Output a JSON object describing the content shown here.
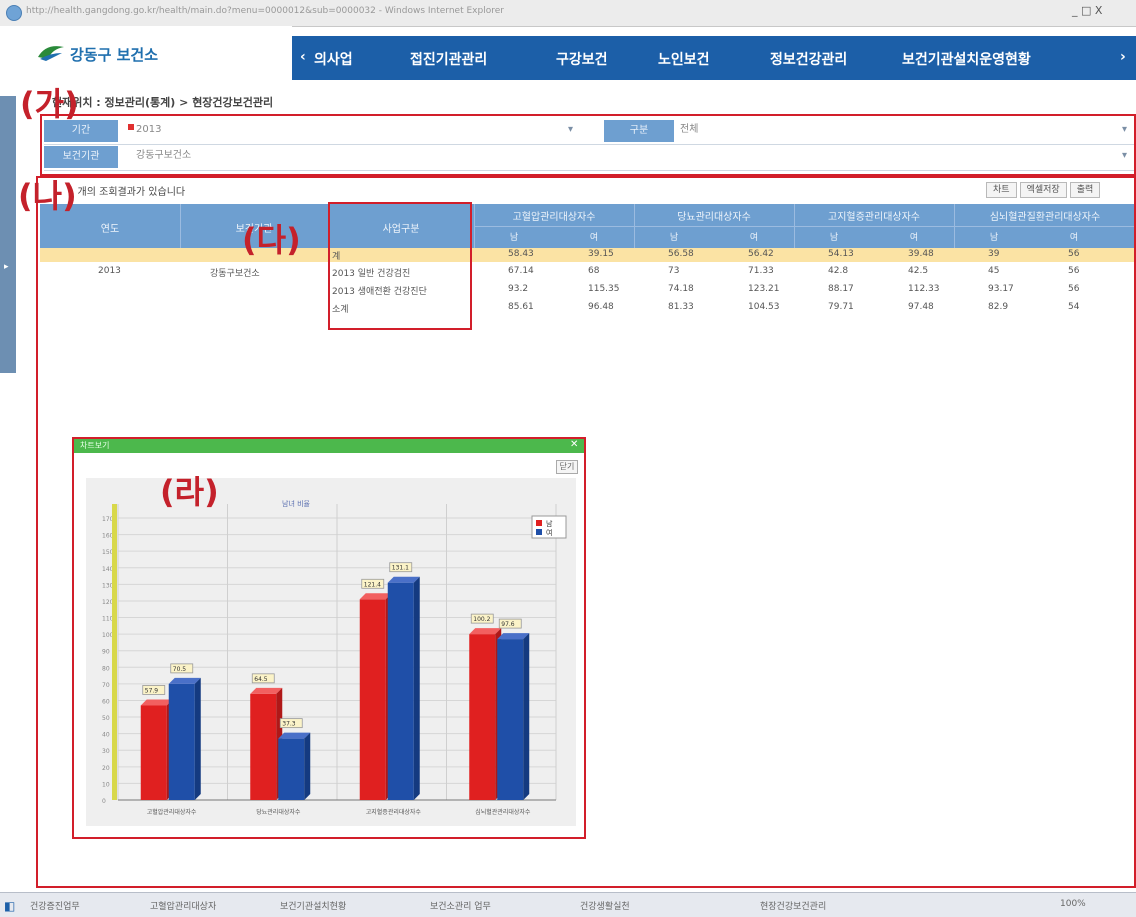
{
  "window": {
    "title": "http://health.gangdong.go.kr/health/main.do?menu=0000012&sub=0000032 - Windows Internet Explorer",
    "controls": "_ □ X"
  },
  "app": {
    "logo_text": "강동구 보건소",
    "nav_prev": "‹",
    "nav_next": "›",
    "nav": [
      "의사업",
      "접진기관관리",
      "구강보건",
      "노인보건",
      "정보건강관리",
      "보건기관설치운영현황"
    ]
  },
  "breadcrumb": "현재위치 : 정보관리(통계) > 현장건강보건관리",
  "filter": {
    "row1": {
      "label1": "기간",
      "value1": "2013",
      "label2": "구분",
      "value2": "전체"
    },
    "row2": {
      "label1": "보건기관",
      "value1": "강동구보건소"
    }
  },
  "results": {
    "title": "1 개의 조회결과가 있습니다",
    "buttons": [
      "차트",
      "엑셀저장",
      "출력"
    ]
  },
  "grid": {
    "headers": [
      "연도",
      "보건기관",
      "사업구분"
    ],
    "groups": [
      "고혈압관리대상자수",
      "당뇨관리대상자수",
      "고지혈증관리대상자수",
      "심뇌혈관질환관리대상자수"
    ],
    "sub": [
      "남",
      "여"
    ],
    "total_label": "계",
    "total_values": [
      "58.43",
      "39.15",
      "56.58",
      "56.42",
      "54.13",
      "39.48",
      "39",
      "56"
    ],
    "rows": [
      {
        "year": "2013",
        "org": "강동구보건소",
        "type": "2013 일반 건강검진",
        "values": [
          "67.14",
          "68",
          "73",
          "71.33",
          "42.8",
          "42.5",
          "45",
          "56"
        ]
      },
      {
        "year": "",
        "org": "",
        "type": "2013 생애전환 건강진단",
        "values": [
          "93.2",
          "115.35",
          "74.18",
          "123.21",
          "88.17",
          "112.33",
          "93.17",
          "56"
        ]
      },
      {
        "year": "",
        "org": "",
        "type": "소계",
        "values": [
          "85.61",
          "96.48",
          "81.33",
          "104.53",
          "79.71",
          "97.48",
          "82.9",
          "54"
        ]
      }
    ]
  },
  "panels": {
    "ga": "(가)",
    "na": "(나)",
    "da": "(다)",
    "ra": "(라)"
  },
  "chart_dialog": {
    "title": "차트보기",
    "close_button": "닫기"
  },
  "chart_data": {
    "type": "bar",
    "title": "남녀 비율",
    "categories": [
      "고혈압관리대상자수",
      "당뇨관리대상자수",
      "고지혈증관리대상자수",
      "심뇌혈관관리대상자수"
    ],
    "series": [
      {
        "name": "남",
        "color": "#e02020",
        "values": [
          57,
          64,
          121,
          100
        ]
      },
      {
        "name": "여",
        "color": "#1f4fa8",
        "values": [
          70,
          37,
          131,
          97
        ]
      }
    ],
    "data_labels": [
      [
        "57.9",
        "70.5"
      ],
      [
        "64.5",
        "37.3"
      ],
      [
        "121.4",
        "131.1"
      ],
      [
        "100.2",
        "97.6"
      ]
    ],
    "ylim": [
      0,
      170
    ],
    "legend_position": "top-right",
    "grid": true
  },
  "taskbar": {
    "items": [
      "건강증진업무",
      "고혈압관리대상자",
      "보건기관설치현황",
      "보건소관리 업무",
      "건강생활실천",
      "현장건강보건관리"
    ],
    "right": "100%"
  }
}
